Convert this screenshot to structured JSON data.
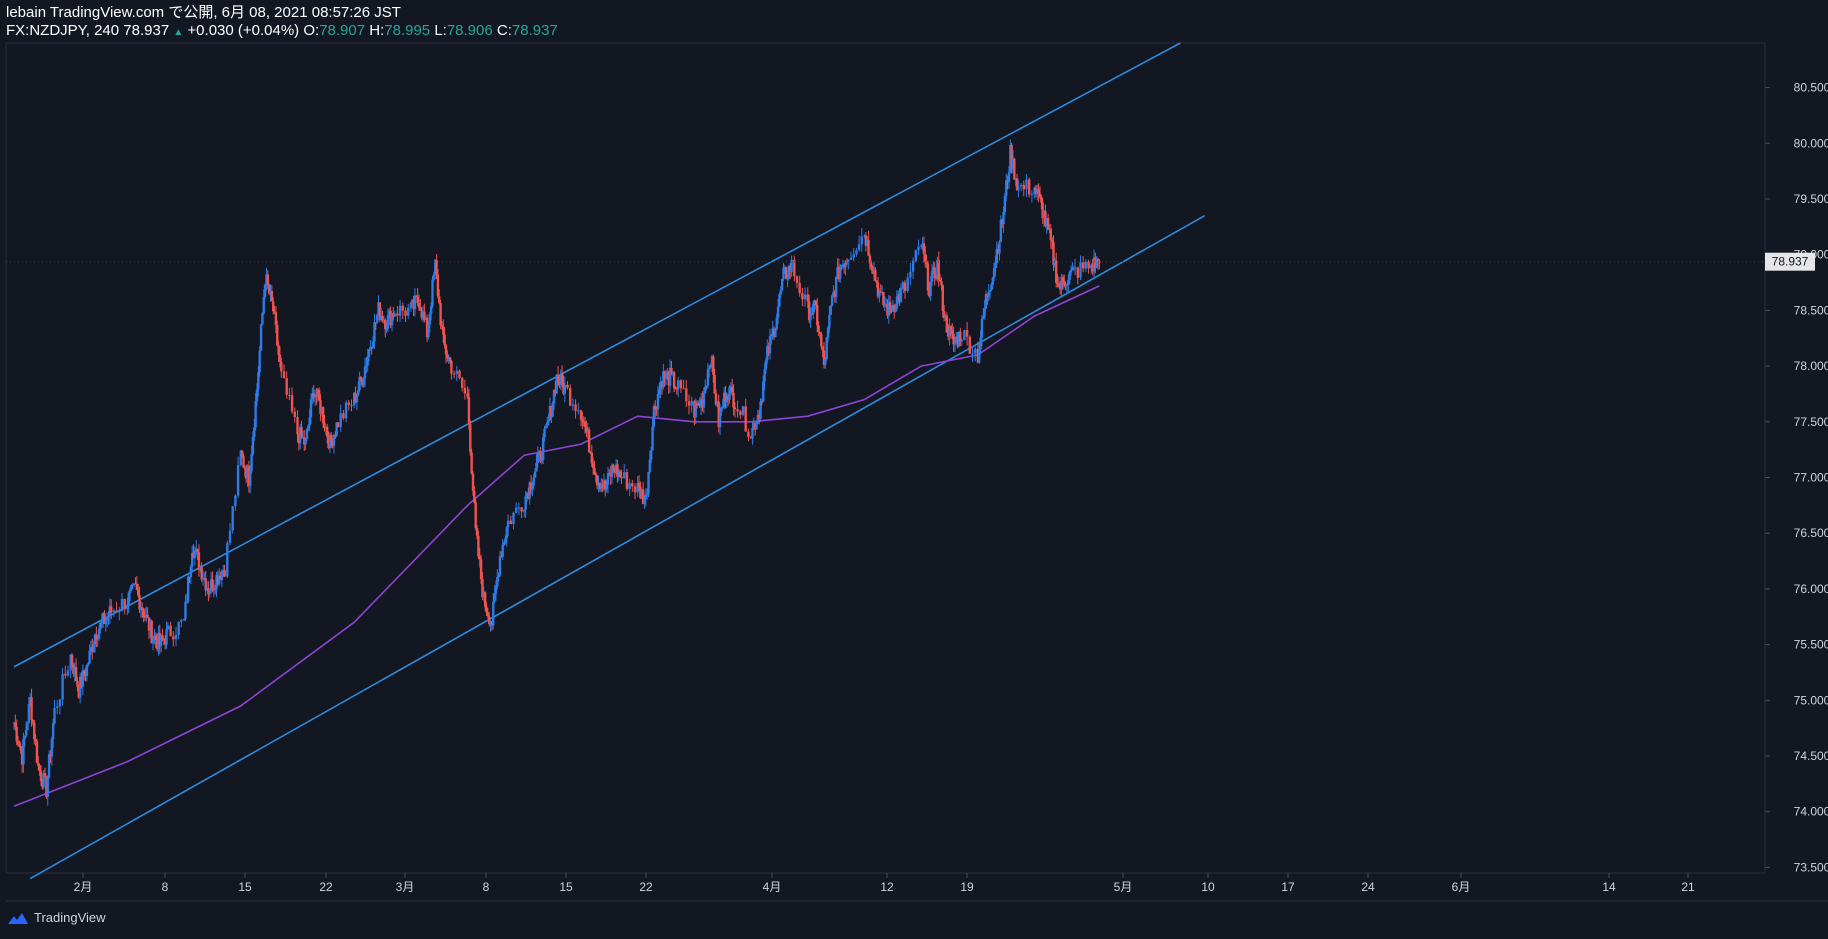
{
  "header": {
    "line1": "lebain TradingView.com で公開, 6月 08, 2021 08:57:26 JST",
    "symbol": "FX:NZDJPY, 240",
    "last": "78.937",
    "change_arrow": "▲",
    "change": "+0.030 (+0.04%)",
    "o_label": "O:",
    "o_value": "78.907",
    "h_label": "H:",
    "h_value": "78.995",
    "l_label": "L:",
    "l_value": "78.906",
    "c_label": "C:",
    "c_value": "78.937"
  },
  "footer": {
    "brand": "TradingView"
  },
  "colors": {
    "background": "#131722",
    "up": "#2d7be5",
    "down": "#ef5350",
    "ma": "#8e44d4",
    "trendline": "#2d8ce0",
    "axis_text": "#d1d4dc",
    "price_tag_bg": "#e6e6e6"
  },
  "icons": {
    "logo": "tradingview-cloud-icon"
  },
  "chart_data": {
    "type": "candlestick",
    "symbol": "FX:NZDJPY",
    "interval": "240",
    "ylim": [
      73.45,
      80.9
    ],
    "y_ticks": [
      "73.500",
      "74.000",
      "74.500",
      "75.000",
      "75.500",
      "76.000",
      "76.500",
      "77.000",
      "77.500",
      "78.000",
      "78.500",
      "79.000",
      "79.500",
      "80.000",
      "80.500"
    ],
    "x_ticks": [
      "2月",
      "8",
      "15",
      "22",
      "3月",
      "8",
      "15",
      "22",
      "4月",
      "12",
      "19",
      "5月",
      "10",
      "17",
      "24",
      "6月",
      "14",
      "21"
    ],
    "last_price": "78.937",
    "close_path": [
      [
        "01-25",
        74.8
      ],
      [
        "01-26",
        74.5
      ],
      [
        "01-27",
        75.0
      ],
      [
        "01-28",
        74.4
      ],
      [
        "01-29",
        74.2
      ],
      [
        "01-30",
        74.9
      ],
      [
        "02-01",
        75.4
      ],
      [
        "02-02",
        75.1
      ],
      [
        "02-03",
        75.3
      ],
      [
        "02-04",
        75.6
      ],
      [
        "02-05",
        75.7
      ],
      [
        "02-06",
        75.8
      ],
      [
        "02-08",
        75.9
      ],
      [
        "02-09",
        76.0
      ],
      [
        "02-10",
        75.8
      ],
      [
        "02-11",
        75.6
      ],
      [
        "02-12",
        75.5
      ],
      [
        "02-13",
        75.6
      ],
      [
        "02-15",
        75.7
      ],
      [
        "02-16",
        76.4
      ],
      [
        "02-17",
        76.2
      ],
      [
        "02-18",
        76.0
      ],
      [
        "02-19",
        76.1
      ],
      [
        "02-20",
        76.2
      ],
      [
        "02-22",
        77.2
      ],
      [
        "02-23",
        77.0
      ],
      [
        "02-24",
        77.8
      ],
      [
        "02-25",
        78.8
      ],
      [
        "02-26",
        78.5
      ],
      [
        "02-27",
        77.9
      ],
      [
        "03-01",
        77.4
      ],
      [
        "03-02",
        77.3
      ],
      [
        "03-03",
        77.8
      ],
      [
        "03-04",
        77.6
      ],
      [
        "03-05",
        77.3
      ],
      [
        "03-06",
        77.5
      ],
      [
        "03-08",
        77.7
      ],
      [
        "03-09",
        77.9
      ],
      [
        "03-10",
        78.2
      ],
      [
        "03-11",
        78.5
      ],
      [
        "03-12",
        78.4
      ],
      [
        "03-13",
        78.5
      ],
      [
        "03-15",
        78.5
      ],
      [
        "03-16",
        78.6
      ],
      [
        "03-17",
        78.3
      ],
      [
        "03-18",
        78.9
      ],
      [
        "03-19",
        78.2
      ],
      [
        "03-20",
        78.0
      ],
      [
        "03-22",
        77.7
      ],
      [
        "03-23",
        76.5
      ],
      [
        "03-24",
        75.9
      ],
      [
        "03-25",
        75.7
      ],
      [
        "03-26",
        76.3
      ],
      [
        "03-27",
        76.6
      ],
      [
        "03-29",
        76.8
      ],
      [
        "03-30",
        77.0
      ],
      [
        "03-31",
        77.2
      ],
      [
        "04-01",
        77.5
      ],
      [
        "04-02",
        77.9
      ],
      [
        "04-03",
        77.8
      ],
      [
        "04-05",
        77.6
      ],
      [
        "04-06",
        77.3
      ],
      [
        "04-07",
        77.0
      ],
      [
        "04-08",
        76.9
      ],
      [
        "04-09",
        77.1
      ],
      [
        "04-10",
        77.0
      ],
      [
        "04-12",
        76.9
      ],
      [
        "04-13",
        76.8
      ],
      [
        "04-14",
        77.6
      ],
      [
        "04-15",
        77.9
      ],
      [
        "04-16",
        77.9
      ],
      [
        "04-17",
        77.8
      ],
      [
        "04-19",
        77.6
      ],
      [
        "04-20",
        77.7
      ],
      [
        "04-21",
        78.1
      ],
      [
        "04-22",
        77.5
      ],
      [
        "04-23",
        77.8
      ],
      [
        "04-24",
        77.7
      ],
      [
        "04-26",
        77.4
      ],
      [
        "04-27",
        77.6
      ],
      [
        "04-28",
        78.1
      ],
      [
        "04-29",
        78.4
      ],
      [
        "04-30",
        78.8
      ],
      [
        "05-01",
        78.9
      ],
      [
        "05-03",
        78.5
      ],
      [
        "05-04",
        78.5
      ],
      [
        "05-05",
        78.0
      ],
      [
        "05-06",
        78.6
      ],
      [
        "05-07",
        78.9
      ],
      [
        "05-08",
        79.0
      ],
      [
        "05-10",
        79.2
      ],
      [
        "05-11",
        78.9
      ],
      [
        "05-12",
        78.6
      ],
      [
        "05-13",
        78.5
      ],
      [
        "05-14",
        78.6
      ],
      [
        "05-15",
        78.7
      ],
      [
        "05-17",
        79.1
      ],
      [
        "05-18",
        78.7
      ],
      [
        "05-19",
        78.9
      ],
      [
        "05-20",
        78.4
      ],
      [
        "05-21",
        78.2
      ],
      [
        "05-22",
        78.3
      ],
      [
        "05-24",
        78.1
      ],
      [
        "05-25",
        78.6
      ],
      [
        "05-26",
        78.9
      ],
      [
        "05-27",
        79.3
      ],
      [
        "05-28",
        79.9
      ],
      [
        "05-29",
        79.6
      ],
      [
        "05-31",
        79.6
      ],
      [
        "06-01",
        79.4
      ],
      [
        "06-02",
        79.1
      ],
      [
        "06-03",
        78.7
      ],
      [
        "06-04",
        78.8
      ],
      [
        "06-05",
        78.85
      ],
      [
        "06-07",
        78.9
      ],
      [
        "06-08",
        78.937
      ]
    ],
    "moving_average": [
      [
        "01-25",
        74.05
      ],
      [
        "02-08",
        74.45
      ],
      [
        "02-22",
        74.95
      ],
      [
        "03-08",
        75.7
      ],
      [
        "03-22",
        76.75
      ],
      [
        "03-29",
        77.2
      ],
      [
        "04-05",
        77.3
      ],
      [
        "04-12",
        77.55
      ],
      [
        "04-19",
        77.5
      ],
      [
        "04-26",
        77.5
      ],
      [
        "05-03",
        77.55
      ],
      [
        "05-10",
        77.7
      ],
      [
        "05-17",
        78.0
      ],
      [
        "05-24",
        78.1
      ],
      [
        "05-31",
        78.45
      ],
      [
        "06-08",
        78.72
      ]
    ],
    "channel": {
      "upper": [
        [
          "01-25",
          75.3
        ],
        [
          "06-18",
          80.9
        ]
      ],
      "lower": [
        [
          "01-27",
          73.4
        ],
        [
          "06-21",
          79.35
        ]
      ]
    }
  }
}
